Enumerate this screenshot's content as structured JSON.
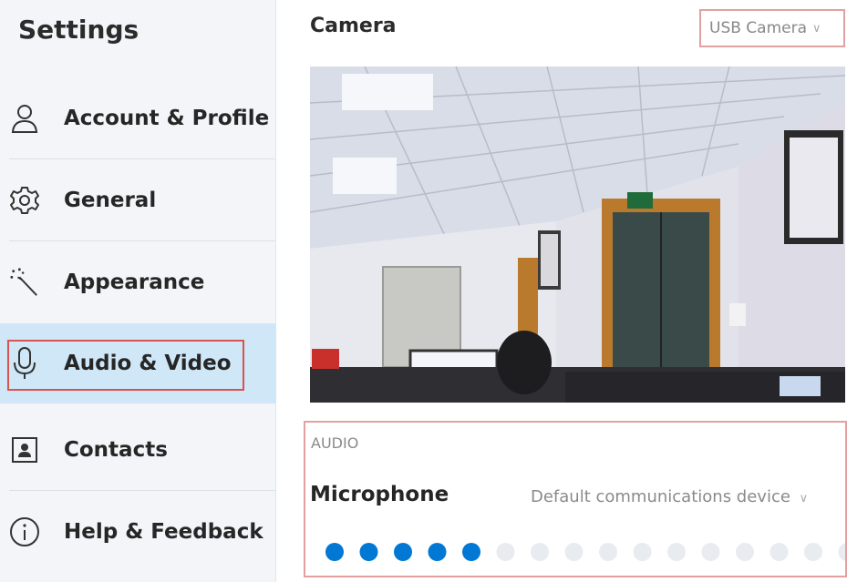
{
  "sidebar": {
    "title": "Settings",
    "items": [
      {
        "label": "Account & Profile",
        "icon": "person-icon"
      },
      {
        "label": "General",
        "icon": "gear-icon"
      },
      {
        "label": "Appearance",
        "icon": "magic-wand-icon"
      },
      {
        "label": "Audio & Video",
        "icon": "microphone-icon",
        "active": true
      },
      {
        "label": "Contacts",
        "icon": "contact-card-icon"
      },
      {
        "label": "Help & Feedback",
        "icon": "info-icon"
      }
    ]
  },
  "camera": {
    "heading": "Camera",
    "selected_device": "USB Camera"
  },
  "audio": {
    "section_label": "AUDIO",
    "microphone_label": "Microphone",
    "microphone_device": "Default communications device",
    "level_active_dots": 5,
    "level_total_dots": 16
  },
  "colors": {
    "accent": "#0078d4",
    "active_bg": "#cfe7f6",
    "highlight_border": "#d9534f",
    "inactive_dot": "#e8ebf0"
  }
}
